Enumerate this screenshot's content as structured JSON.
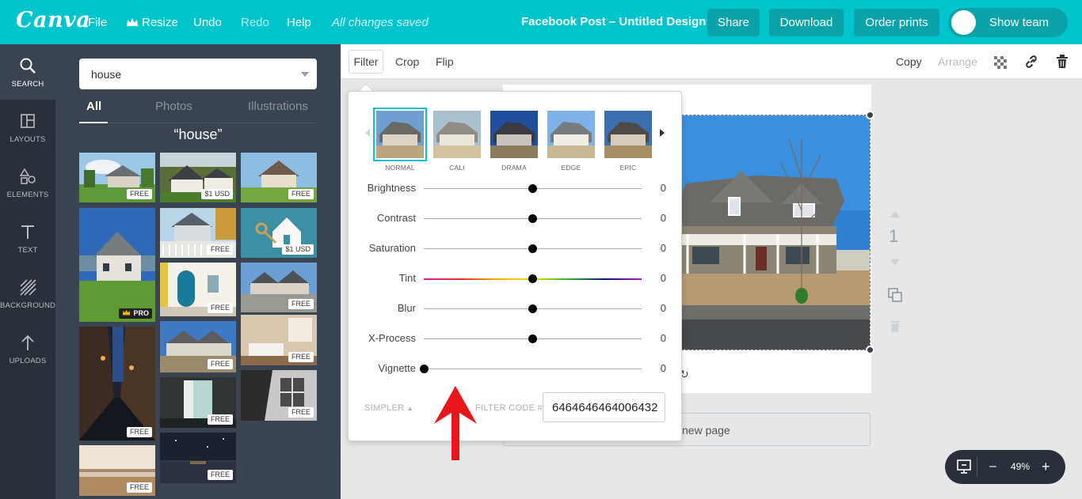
{
  "topbar": {
    "logo": "Canva",
    "menu": {
      "file": "File",
      "resize": "Resize",
      "undo": "Undo",
      "redo": "Redo",
      "help": "Help"
    },
    "status": "All changes saved",
    "doc_title": "Facebook Post – Untitled Design",
    "buttons": {
      "share": "Share",
      "download": "Download",
      "order_prints": "Order prints"
    },
    "show_team": "Show team"
  },
  "rail": {
    "items": [
      {
        "label": "SEARCH",
        "icon": "search-icon"
      },
      {
        "label": "LAYOUTS",
        "icon": "layouts-icon"
      },
      {
        "label": "ELEMENTS",
        "icon": "elements-icon"
      },
      {
        "label": "TEXT",
        "icon": "text-icon"
      },
      {
        "label": "BACKGROUND",
        "icon": "background-icon"
      },
      {
        "label": "UPLOADS",
        "icon": "uploads-icon"
      }
    ]
  },
  "search": {
    "value": "house",
    "tabs": [
      "All",
      "Photos",
      "Illustrations"
    ],
    "query_title": "“house”",
    "badges": {
      "free": "FREE",
      "usd": "$1 USD",
      "pro": "PRO"
    }
  },
  "toolbar": {
    "filter": "Filter",
    "crop": "Crop",
    "flip": "Flip",
    "copy": "Copy",
    "arrange": "Arrange"
  },
  "filter_panel": {
    "presets": [
      "NORMAL",
      "CALI",
      "DRAMA",
      "EDGE",
      "EPIC"
    ],
    "selected_preset": "NORMAL",
    "sliders": [
      {
        "label": "Brightness",
        "value": "0",
        "position": 0.5
      },
      {
        "label": "Contrast",
        "value": "0",
        "position": 0.5
      },
      {
        "label": "Saturation",
        "value": "0",
        "position": 0.5
      },
      {
        "label": "Tint",
        "value": "0",
        "position": 0.5
      },
      {
        "label": "Blur",
        "value": "0",
        "position": 0.5
      },
      {
        "label": "X-Process",
        "value": "0",
        "position": 0.5
      },
      {
        "label": "Vignette",
        "value": "0",
        "position": 0.0
      }
    ],
    "simpler": "SIMPLER",
    "filter_code_label": "FILTER CODE #",
    "filter_code": "6464646464006432"
  },
  "canvas": {
    "add_page": "new page",
    "page_number": "1"
  },
  "zoom": {
    "value": "49%",
    "minus": "–",
    "plus": "+"
  },
  "colors": {
    "brand": "#00c4cc",
    "rail": "#293039",
    "panel": "#3a4450"
  }
}
